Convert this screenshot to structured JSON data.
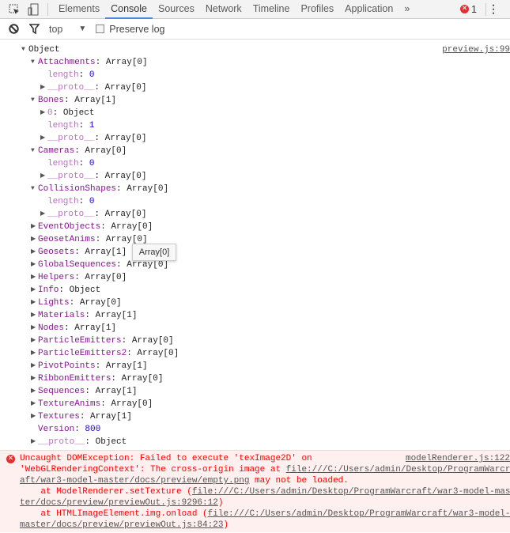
{
  "tabs": [
    "Elements",
    "Console",
    "Sources",
    "Network",
    "Timeline",
    "Profiles",
    "Application"
  ],
  "active_tab": "Console",
  "more_tabs": "»",
  "error_count": "1",
  "toolbar": {
    "context": "top",
    "preserve_log": "Preserve log"
  },
  "log": {
    "source": "preview.js:99",
    "rows": [
      {
        "d": 0,
        "a": "open",
        "v": "Object"
      },
      {
        "d": 1,
        "a": "open",
        "k": "Attachments",
        "v": "Array[0]"
      },
      {
        "d": 2,
        "k": "length",
        "dim": true,
        "n": "0"
      },
      {
        "d": 2,
        "a": "closed",
        "k": "__proto__",
        "dim": true,
        "v": "Array[0]"
      },
      {
        "d": 1,
        "a": "open",
        "k": "Bones",
        "v": "Array[1]"
      },
      {
        "d": 2,
        "a": "closed",
        "k": "0",
        "dim": true,
        "v": "Object"
      },
      {
        "d": 2,
        "k": "length",
        "dim": true,
        "n": "1"
      },
      {
        "d": 2,
        "a": "closed",
        "k": "__proto__",
        "dim": true,
        "v": "Array[0]"
      },
      {
        "d": 1,
        "a": "open",
        "k": "Cameras",
        "v": "Array[0]"
      },
      {
        "d": 2,
        "k": "length",
        "dim": true,
        "n": "0"
      },
      {
        "d": 2,
        "a": "closed",
        "k": "__proto__",
        "dim": true,
        "v": "Array[0]"
      },
      {
        "d": 1,
        "a": "open",
        "k": "CollisionShapes",
        "v": "Array[0]"
      },
      {
        "d": 2,
        "k": "length",
        "dim": true,
        "n": "0"
      },
      {
        "d": 2,
        "a": "closed",
        "k": "__proto__",
        "dim": true,
        "v": "Array[0]"
      },
      {
        "d": 1,
        "a": "closed",
        "k": "EventObjects",
        "v": "Array[0]"
      },
      {
        "d": 1,
        "a": "closed",
        "k": "GeosetAnims",
        "v": "Array[0]"
      },
      {
        "d": 1,
        "a": "closed",
        "k": "Geosets",
        "v": "Array[1]"
      },
      {
        "d": 1,
        "a": "closed",
        "k": "GlobalSequences",
        "v": "Array[0]"
      },
      {
        "d": 1,
        "a": "closed",
        "k": "Helpers",
        "v": "Array[0]"
      },
      {
        "d": 1,
        "a": "closed",
        "k": "Info",
        "v": "Object"
      },
      {
        "d": 1,
        "a": "closed",
        "k": "Lights",
        "v": "Array[0]"
      },
      {
        "d": 1,
        "a": "closed",
        "k": "Materials",
        "v": "Array[1]"
      },
      {
        "d": 1,
        "a": "closed",
        "k": "Nodes",
        "v": "Array[1]"
      },
      {
        "d": 1,
        "a": "closed",
        "k": "ParticleEmitters",
        "v": "Array[0]"
      },
      {
        "d": 1,
        "a": "closed",
        "k": "ParticleEmitters2",
        "v": "Array[0]"
      },
      {
        "d": 1,
        "a": "closed",
        "k": "PivotPoints",
        "v": "Array[1]"
      },
      {
        "d": 1,
        "a": "closed",
        "k": "RibbonEmitters",
        "v": "Array[0]"
      },
      {
        "d": 1,
        "a": "closed",
        "k": "Sequences",
        "v": "Array[1]"
      },
      {
        "d": 1,
        "a": "closed",
        "k": "TextureAnims",
        "v": "Array[0]"
      },
      {
        "d": 1,
        "a": "closed",
        "k": "Textures",
        "v": "Array[1]"
      },
      {
        "d": 1,
        "k": "Version",
        "n": "800"
      },
      {
        "d": 1,
        "a": "closed",
        "k": "__proto__",
        "dim": true,
        "v": "Object"
      }
    ]
  },
  "tooltip": "Array[0]",
  "error": {
    "source": "modelRenderer.js:122",
    "l1": "Uncaught DOMException: Failed to execute 'texImage2D' on",
    "l2a": "'WebGLRenderingContext': The cross-origin image at ",
    "l2b": "file:///C:/Users/admin/Desktop/ProgramWarcr",
    "l3a": "aft/war3-model-master/docs/preview/empty.png",
    "l3b": " may not be loaded.",
    "l4a": "    at ModelRenderer.setTexture (",
    "l4b": "file:///C:/Users/admin/Desktop/ProgramWarcraft/war3-model-mas",
    "l5a": "ter/docs/preview/previewOut.js:9296:12",
    "l6a": "    at HTMLImageElement.img.onload (",
    "l6b": "file:///C:/Users/admin/Desktop/ProgramWarcraft/war3-model-",
    "l7a": "master/docs/preview/previewOut.js:84:23"
  }
}
